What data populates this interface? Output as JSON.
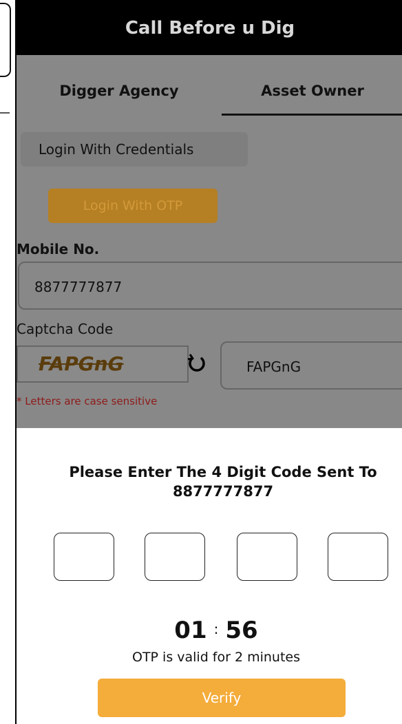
{
  "app": {
    "title": "Call Before u Dig"
  },
  "tabs": [
    {
      "label": "Digger Agency",
      "active": false
    },
    {
      "label": "Asset Owner",
      "active": true
    }
  ],
  "login": {
    "credentials_label": "Login With Credentials",
    "otp_label": "Login With OTP",
    "mobile_label": "Mobile No.",
    "mobile_value": "8877777877",
    "captcha_label": "Captcha Code",
    "captcha_image_text": "FAPGnG",
    "captcha_value": "FAPGnG",
    "case_note": "* Letters are case sensitive"
  },
  "otp_sheet": {
    "title_line1": "Please Enter The 4 Digit Code Sent To",
    "title_line2": "8877777877",
    "digits": [
      "",
      "",
      "",
      ""
    ],
    "timer_minutes": "01",
    "timer_separator": ":",
    "timer_seconds": "56",
    "validity_note": "OTP is valid for 2 minutes",
    "verify_label": "Verify"
  },
  "colors": {
    "accent": "#f4ac3a",
    "titlebar": "#000000",
    "overlay": "#888888",
    "error_text": "#8f1a1a"
  },
  "icons": {
    "refresh": "refresh-icon"
  }
}
